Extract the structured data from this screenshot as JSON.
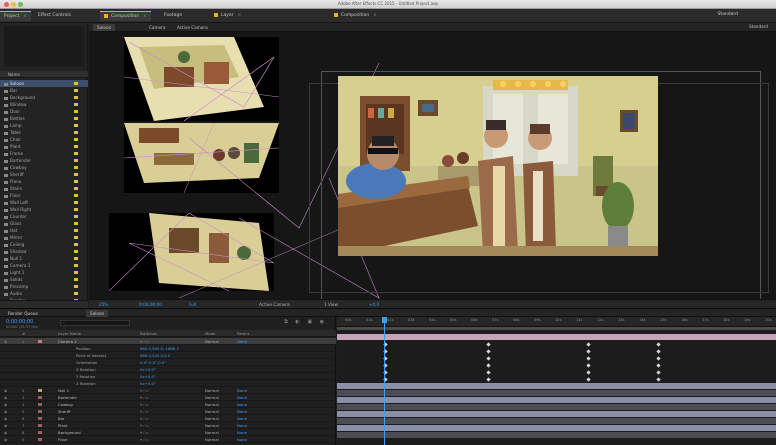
{
  "window": {
    "title": "Adobe After Effects CC 2015 - Untitled Project.aep"
  },
  "tabs": [
    {
      "label": "Project",
      "active": true
    },
    {
      "label": "Effect Controls",
      "active": false
    },
    {
      "label": "Composition",
      "active": true
    },
    {
      "label": "Footage",
      "active": false
    },
    {
      "label": "Layer",
      "active": false
    },
    {
      "label": "Composition",
      "active": false
    }
  ],
  "workspace": {
    "label": "Standard"
  },
  "viewer": {
    "subtabs": [
      "Saloon",
      "Camera",
      "Active Camera"
    ],
    "right_label": "Standard",
    "controls": {
      "zoom": "25%",
      "timecode": "0;00;00;00",
      "resolution": "Full",
      "camera": "Active Camera",
      "views": "1 View",
      "exposure": "+0.0"
    }
  },
  "project": {
    "header": "Name",
    "items": [
      {
        "label": "Saloon",
        "tag": "#e0c040"
      },
      {
        "label": "Bar",
        "tag": "#e0c040"
      },
      {
        "label": "Background",
        "tag": "#e0c040"
      },
      {
        "label": "Window",
        "tag": "#e0c040"
      },
      {
        "label": "Door",
        "tag": "#e0c040"
      },
      {
        "label": "Bottles",
        "tag": "#e0c040"
      },
      {
        "label": "Lamp",
        "tag": "#e0c040"
      },
      {
        "label": "Table",
        "tag": "#e0c040"
      },
      {
        "label": "Chair",
        "tag": "#e0c040"
      },
      {
        "label": "Plant",
        "tag": "#e0c040"
      },
      {
        "label": "Frame",
        "tag": "#e0c040"
      },
      {
        "label": "Bartender",
        "tag": "#e0c040"
      },
      {
        "label": "Cowboy",
        "tag": "#e0c040"
      },
      {
        "label": "Sheriff",
        "tag": "#e0c040"
      },
      {
        "label": "Piano",
        "tag": "#e0c040"
      },
      {
        "label": "Stairs",
        "tag": "#e0c040"
      },
      {
        "label": "Floor",
        "tag": "#e0c040"
      },
      {
        "label": "Wall Left",
        "tag": "#e0c040"
      },
      {
        "label": "Wall Right",
        "tag": "#e0c040"
      },
      {
        "label": "Counter",
        "tag": "#e0c040"
      },
      {
        "label": "Glass",
        "tag": "#e0c040"
      },
      {
        "label": "Hat",
        "tag": "#e0c040"
      },
      {
        "label": "Mirror",
        "tag": "#e0c040"
      },
      {
        "label": "Ceiling",
        "tag": "#e0c040"
      },
      {
        "label": "Shadow",
        "tag": "#e0c040"
      },
      {
        "label": "Null 1",
        "tag": "#e0c040"
      },
      {
        "label": "Camera 1",
        "tag": "#e0c040"
      },
      {
        "label": "Light 1",
        "tag": "#e0c040"
      },
      {
        "label": "Solids",
        "tag": "#e0c040"
      },
      {
        "label": "Precomp",
        "tag": "#e0c040"
      },
      {
        "label": "Audio",
        "tag": "#e0c040"
      },
      {
        "label": "Render",
        "tag": "#e0c040"
      },
      {
        "label": "Saloon_final",
        "tag": "#e0c040"
      }
    ]
  },
  "timeline": {
    "tabs": [
      "Render Queue",
      "Saloon"
    ],
    "timecode": "0;00;00;00",
    "fps": "00000 (29.97 fps)",
    "header": {
      "num": "#",
      "name": "Layer Name",
      "switches": "Switches",
      "mode": "Mode",
      "parent": "Parent"
    },
    "ruler": [
      "00s",
      "01s",
      "02s",
      "03s",
      "04s",
      "05s",
      "06s",
      "07s",
      "08s",
      "09s",
      "10s",
      "11s",
      "12s",
      "13s",
      "14s",
      "15s",
      "16s",
      "17s",
      "18s",
      "19s",
      "20s"
    ],
    "layers": [
      {
        "num": "1",
        "name": "Camera 1",
        "color": "#c08080",
        "mode": "Normal",
        "parent": "None",
        "sel": true
      },
      {
        "num": "",
        "name": "Position",
        "prop": true,
        "value": "960.0,540.0,-1866.7"
      },
      {
        "num": "",
        "name": "Point of Interest",
        "prop": true,
        "value": "960.0,540.0,0.0"
      },
      {
        "num": "",
        "name": "Orientation",
        "prop": true,
        "value": "0.0°,0.0°,0.0°"
      },
      {
        "num": "",
        "name": "X Rotation",
        "prop": true,
        "value": "0x+0.0°"
      },
      {
        "num": "",
        "name": "Y Rotation",
        "prop": true,
        "value": "0x+0.0°"
      },
      {
        "num": "",
        "name": "Z Rotation",
        "prop": true,
        "value": "0x+0.0°"
      },
      {
        "num": "2",
        "name": "Null 1",
        "color": "#c0a060",
        "mode": "Normal",
        "parent": "None"
      },
      {
        "num": "3",
        "name": "Bartender",
        "color": "#a06060",
        "mode": "Normal",
        "parent": "None"
      },
      {
        "num": "4",
        "name": "Cowboy",
        "color": "#a06060",
        "mode": "Normal",
        "parent": "None"
      },
      {
        "num": "5",
        "name": "Sheriff",
        "color": "#a06060",
        "mode": "Normal",
        "parent": "None"
      },
      {
        "num": "6",
        "name": "Bar",
        "color": "#a06060",
        "mode": "Normal",
        "parent": "None"
      },
      {
        "num": "7",
        "name": "Plant",
        "color": "#a06060",
        "mode": "Normal",
        "parent": "None"
      },
      {
        "num": "8",
        "name": "Background",
        "color": "#a06060",
        "mode": "Normal",
        "parent": "None"
      },
      {
        "num": "9",
        "name": "Floor",
        "color": "#a06060",
        "mode": "Normal",
        "parent": "None"
      }
    ]
  },
  "colors": {
    "accent": "#3aa0ff",
    "label_yellow": "#f0b400",
    "camera_bar": "#c7a3b6",
    "layer_bar": "#8a8fa8",
    "dark_bar": "#4c4c55"
  }
}
